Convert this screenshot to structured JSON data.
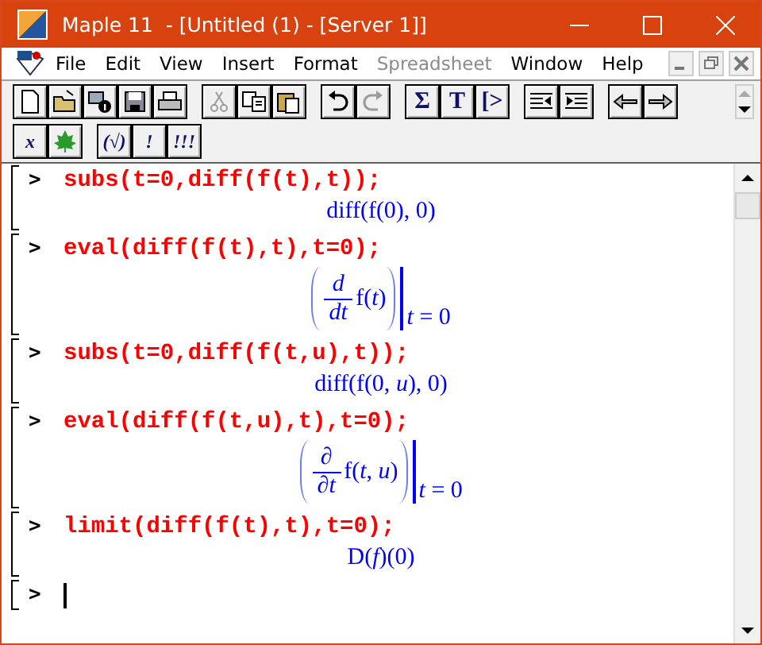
{
  "window": {
    "title": "Maple 11  - [Untitled (1) - [Server 1]]"
  },
  "menu": [
    {
      "label": "File",
      "disabled": false
    },
    {
      "label": "Edit",
      "disabled": false
    },
    {
      "label": "View",
      "disabled": false
    },
    {
      "label": "Insert",
      "disabled": false
    },
    {
      "label": "Format",
      "disabled": false
    },
    {
      "label": "Spreadsheet",
      "disabled": true
    },
    {
      "label": "Window",
      "disabled": false
    },
    {
      "label": "Help",
      "disabled": false
    }
  ],
  "toolbar_rows": [
    [
      [
        {
          "kind": "new",
          "disabled": false
        },
        {
          "kind": "open",
          "disabled": false
        },
        {
          "kind": "info",
          "disabled": false
        },
        {
          "kind": "save",
          "disabled": false
        },
        {
          "kind": "print",
          "disabled": false
        }
      ],
      [
        {
          "kind": "cut",
          "disabled": true
        },
        {
          "kind": "copy",
          "disabled": false
        },
        {
          "kind": "paste",
          "disabled": false
        }
      ],
      [
        {
          "kind": "undo",
          "disabled": false
        },
        {
          "kind": "redo",
          "disabled": true
        }
      ],
      [
        {
          "kind": "text",
          "label": "Σ",
          "disabled": false
        },
        {
          "kind": "text",
          "label": "T",
          "disabled": false
        },
        {
          "kind": "text",
          "label": "[>",
          "disabled": false
        }
      ],
      [
        {
          "kind": "outdent",
          "disabled": false
        },
        {
          "kind": "indent",
          "disabled": false
        }
      ],
      [
        {
          "kind": "back",
          "disabled": false
        },
        {
          "kind": "forward",
          "disabled": false
        }
      ]
    ],
    [
      [
        {
          "kind": "text",
          "label": "x",
          "disabled": false
        },
        {
          "kind": "leaf",
          "disabled": false
        }
      ],
      [
        {
          "kind": "text",
          "label": "(√)",
          "disabled": false
        },
        {
          "kind": "text",
          "label": "!",
          "disabled": false
        },
        {
          "kind": "text",
          "label": "!!!",
          "disabled": false
        }
      ]
    ]
  ],
  "worksheet": {
    "groups": [
      {
        "prompt": ">",
        "input": "subs(t=0,diff(f(t),t));",
        "output": {
          "kind": "plain",
          "text": "diff(f(0), 0)"
        },
        "cursor": false
      },
      {
        "prompt": ">",
        "input": "eval(diff(f(t),t),t=0);",
        "output": {
          "kind": "eval_at",
          "numerator": "*d*",
          "denominator": "*dt*",
          "expression": "f(*t*)",
          "condition": "*t* = 0"
        },
        "cursor": false
      },
      {
        "prompt": ">",
        "input": "subs(t=0,diff(f(t,u),t));",
        "output": {
          "kind": "plain",
          "text": "diff(f(0, *u*), 0)"
        },
        "cursor": false
      },
      {
        "prompt": ">",
        "input": "eval(diff(f(t,u),t),t=0);",
        "output": {
          "kind": "eval_at",
          "numerator": "∂",
          "denominator": "∂*t*",
          "expression": "f(*t*, *u*)",
          "condition": "*t* = 0"
        },
        "cursor": false
      },
      {
        "prompt": ">",
        "input": "limit(diff(f(t),t),t=0);",
        "output": {
          "kind": "plain",
          "text": "D(*f*)(0)"
        },
        "cursor": false
      },
      {
        "prompt": ">",
        "cursor": true
      }
    ]
  }
}
